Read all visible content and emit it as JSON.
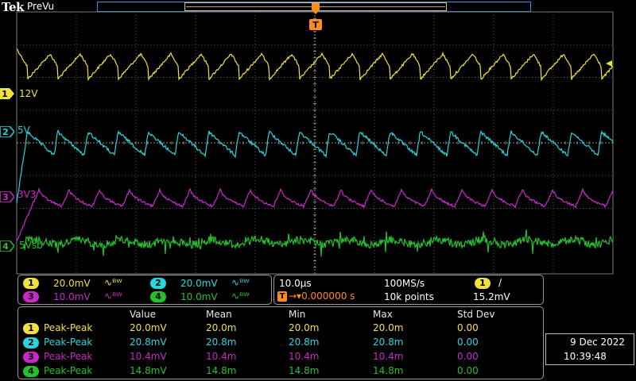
{
  "header": {
    "brand": "Tek",
    "mode": "PreVu"
  },
  "colors": {
    "ch1": "#f0e040",
    "ch2": "#27d5dc",
    "ch3": "#c928c9",
    "ch4": "#22c22a",
    "trigger": "#ff8c1a",
    "grid": "#5a5a5a"
  },
  "trigger": {
    "marker": "T",
    "position_label": "0.000000 s"
  },
  "channels": [
    {
      "num": "1",
      "name": "12V",
      "scale": "20.0mV",
      "bw": "ᴮᵂ"
    },
    {
      "num": "2",
      "name": "5V",
      "scale": "20.0mV",
      "bw": "ᴮᵂ"
    },
    {
      "num": "3",
      "name": "3V3",
      "scale": "10.0mV",
      "bw": "ᴮᵂ"
    },
    {
      "num": "4",
      "name": "5Vsb",
      "scale": "10.0mV",
      "bw": "ᴮᵂ"
    }
  ],
  "timebase": {
    "horizontal": "10.0µs",
    "sample_rate": "100MS/s",
    "record_length": "10k points",
    "trigger_source": "1",
    "trigger_slope": "∕",
    "trigger_level": "15.2mV"
  },
  "measurements": {
    "headers": [
      "Value",
      "Mean",
      "Min",
      "Max",
      "Std Dev"
    ],
    "rows": [
      {
        "ch": "1",
        "type": "Peak-Peak",
        "value": "20.0mV",
        "mean": "20.0m",
        "min": "20.0m",
        "max": "20.0m",
        "std": "0.00"
      },
      {
        "ch": "2",
        "type": "Peak-Peak",
        "value": "20.8mV",
        "mean": "20.8m",
        "min": "20.8m",
        "max": "20.8m",
        "std": "0.00"
      },
      {
        "ch": "3",
        "type": "Peak-Peak",
        "value": "10.4mV",
        "mean": "10.4m",
        "min": "10.4m",
        "max": "10.4m",
        "std": "0.00"
      },
      {
        "ch": "4",
        "type": "Peak-Peak",
        "value": "14.8mV",
        "mean": "14.8m",
        "min": "14.8m",
        "max": "14.8m",
        "std": "0.00"
      }
    ]
  },
  "datetime": {
    "date": "9 Dec 2022",
    "time": "10:39:48"
  }
}
